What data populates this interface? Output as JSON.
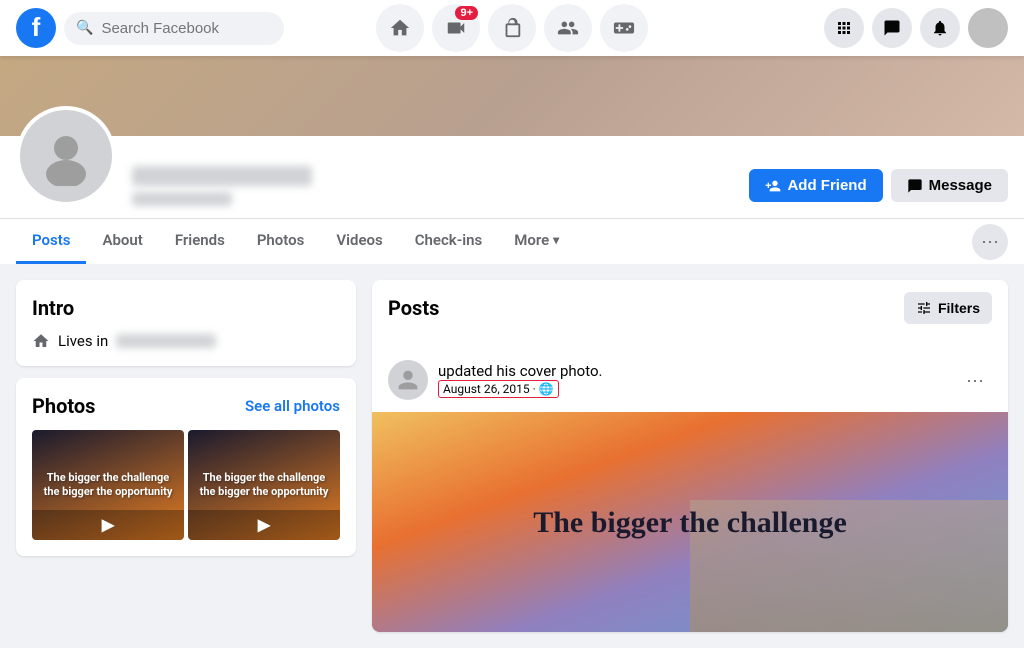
{
  "topbar": {
    "search_placeholder": "Search Facebook",
    "nav_icons": [
      {
        "name": "home-icon",
        "symbol": "⌂"
      },
      {
        "name": "video-icon",
        "symbol": "▶",
        "badge": "9+"
      },
      {
        "name": "marketplace-icon",
        "symbol": "🏪"
      },
      {
        "name": "groups-icon",
        "symbol": "👥"
      },
      {
        "name": "gaming-icon",
        "symbol": "🎮"
      }
    ],
    "right_icons": [
      {
        "name": "apps-icon",
        "symbol": "⋯"
      },
      {
        "name": "messenger-icon",
        "symbol": "💬"
      },
      {
        "name": "notifications-icon",
        "symbol": "🔔"
      }
    ]
  },
  "profile": {
    "add_friend_label": "Add Friend",
    "message_label": "Message"
  },
  "nav_tabs": {
    "tabs": [
      {
        "label": "Posts",
        "active": true
      },
      {
        "label": "About"
      },
      {
        "label": "Friends"
      },
      {
        "label": "Photos"
      },
      {
        "label": "Videos"
      },
      {
        "label": "Check-ins"
      },
      {
        "label": "More"
      }
    ]
  },
  "intro": {
    "title": "Intro",
    "lives_label": "Lives in"
  },
  "photos": {
    "title": "Photos",
    "see_all_label": "See all photos",
    "items": [
      {
        "text": "The bigger the challenge the bigger the opportunity"
      },
      {
        "text": "The bigger the challenge the bigger the opportunity"
      }
    ]
  },
  "posts": {
    "title": "Posts",
    "filters_label": "Filters",
    "post": {
      "action": "updated his cover photo.",
      "date": "August 26, 2015 · 🌐",
      "image_text": "The bigger the challenge"
    }
  }
}
